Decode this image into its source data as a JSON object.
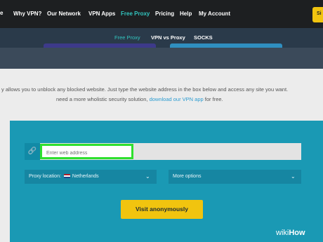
{
  "nav": {
    "logo_fragment": "e",
    "items": [
      "Why VPN?",
      "Our Network",
      "VPN Apps",
      "Free Proxy",
      "Pricing",
      "Help",
      "My Account"
    ],
    "signup_fragment": "Si"
  },
  "subnav": {
    "items": [
      "Free Proxy",
      "VPN vs Proxy",
      "SOCKS"
    ]
  },
  "description": {
    "line1": "y allows you to unblock any blocked website. Just type the website address in the box below and access any site you want.",
    "line2_pre": "need a more wholistic security solution, ",
    "line2_link": "download our VPN app",
    "line2_post": " for free."
  },
  "form": {
    "url_placeholder": "Enter web address",
    "proxy_location_label": "Proxy location:",
    "proxy_location_value": "Netherlands",
    "more_options": "More options",
    "submit": "Visit anonymously"
  },
  "watermark": {
    "brand_a": "wiki",
    "brand_b": "How"
  }
}
